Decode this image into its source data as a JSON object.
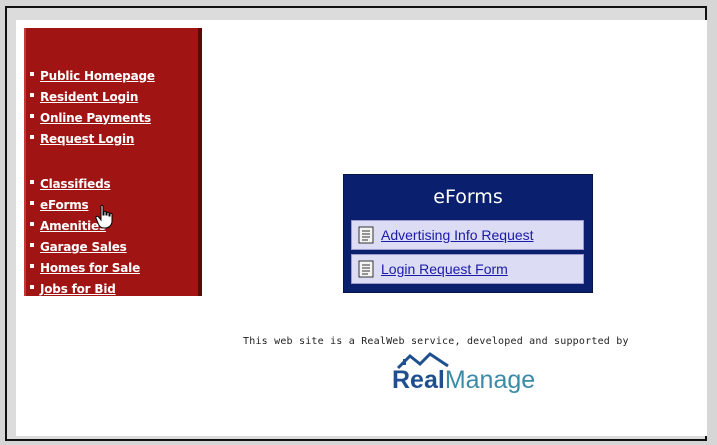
{
  "sidebar": {
    "group1": [
      {
        "label": "Public Homepage"
      },
      {
        "label": "Resident Login"
      },
      {
        "label": "Online Payments"
      },
      {
        "label": "Request Login"
      }
    ],
    "group2": [
      {
        "label": "Classifieds"
      },
      {
        "label": "eForms"
      },
      {
        "label": "Amenities"
      },
      {
        "label": "Garage Sales"
      },
      {
        "label": "Homes for Sale"
      },
      {
        "label": "Jobs for Bid"
      }
    ]
  },
  "eforms": {
    "title": "eForms",
    "items": [
      {
        "label": "Advertising Info Request",
        "icon": "document-icon"
      },
      {
        "label": "Login Request Form",
        "icon": "document-icon"
      }
    ]
  },
  "footer": {
    "text": "This web site is a RealWeb service, developed and supported by",
    "logo_part1": "Real",
    "logo_part2": "Manage"
  },
  "colors": {
    "sidebar_bg": "#a01414",
    "eforms_bg": "#0a1f6e",
    "link_blue": "#1a1aa8"
  }
}
